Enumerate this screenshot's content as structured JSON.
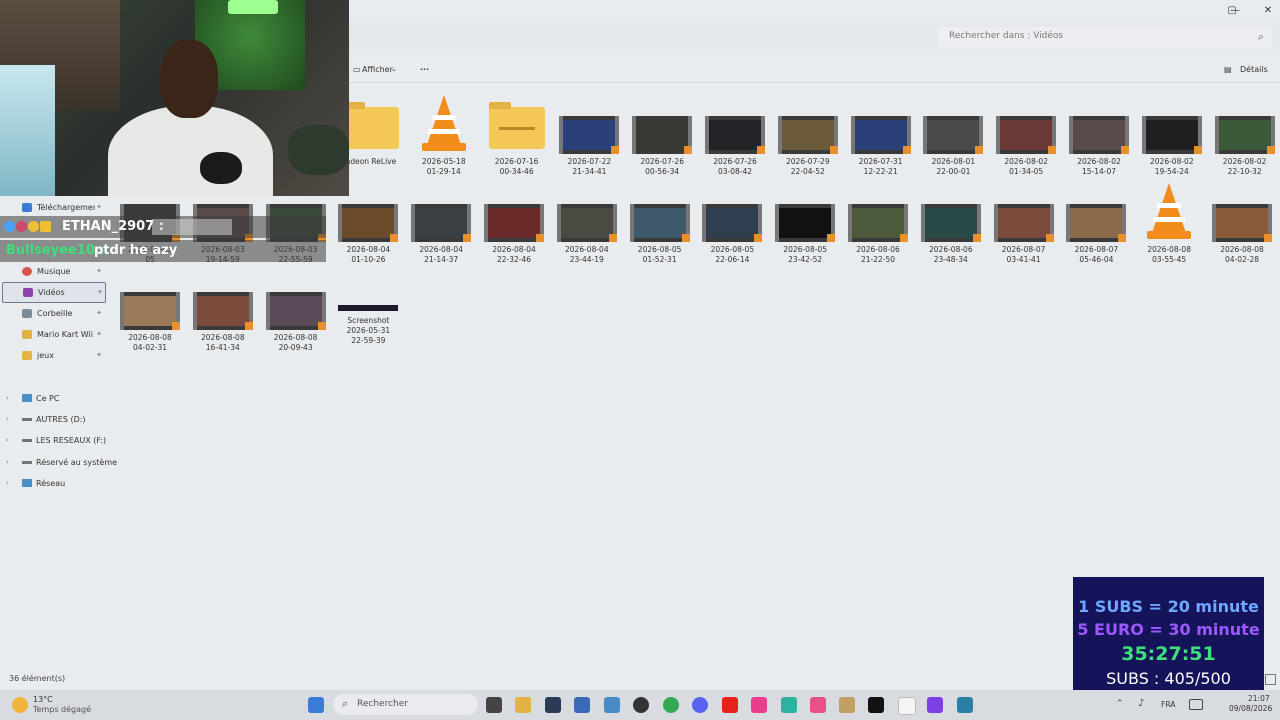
{
  "window": {
    "search_placeholder": "Rechercher dans : Vidéos",
    "search_icon": "search-icon",
    "minimize": "—",
    "maximize": "▢",
    "close": "✕"
  },
  "toolbar": {
    "view_label": "Afficher",
    "more_label": "···",
    "details_label": "Détails"
  },
  "sidebar": {
    "quick_access": [
      {
        "label": "Téléchargement",
        "icon": "download-icon",
        "color": "#3a7bd5"
      },
      {
        "label": "Musique",
        "icon": "music-icon",
        "color": "#d9534f"
      },
      {
        "label": "Vidéos",
        "icon": "video-icon",
        "color": "#8e44ad"
      },
      {
        "label": "Corbeille",
        "icon": "recycle-bin-icon",
        "color": "#7a8a99"
      },
      {
        "label": "Mario Kart Wii (F",
        "icon": "folder-icon",
        "color": "#e2b244"
      },
      {
        "label": "jeux",
        "icon": "folder-icon",
        "color": "#e2b244"
      }
    ],
    "tree": [
      {
        "label": "Ce PC",
        "icon": "pc-icon"
      },
      {
        "label": "AUTRES (D:)",
        "icon": "drive-icon"
      },
      {
        "label": "LES RESEAUX (F:)",
        "icon": "drive-icon"
      },
      {
        "label": "Réservé au système",
        "icon": "drive-icon"
      },
      {
        "label": "Réseau",
        "icon": "network-icon"
      }
    ]
  },
  "files_row1": [
    {
      "line1": "adeon ReLive",
      "line2": "",
      "kind": "folder"
    },
    {
      "line1": "2026-05-18",
      "line2": "01-29-14",
      "kind": "vlc"
    },
    {
      "line1": "2026-07-16",
      "line2": "00-34-46",
      "kind": "zipfolder"
    },
    {
      "line1": "2026-07-22",
      "line2": "21-34-41",
      "kind": "video",
      "tint": "#2b3f78"
    },
    {
      "line1": "2026-07-26",
      "line2": "00-56-34",
      "kind": "video",
      "tint": "#3a3a34"
    },
    {
      "line1": "2026-07-26",
      "line2": "03-08-42",
      "kind": "video",
      "tint": "#222428"
    },
    {
      "line1": "2026-07-29",
      "line2": "22-04-52",
      "kind": "video",
      "tint": "#6a5a3a"
    },
    {
      "line1": "2026-07-31",
      "line2": "12-22-21",
      "kind": "video",
      "tint": "#2b3f78"
    },
    {
      "line1": "2026-08-01",
      "line2": "22-00-01",
      "kind": "video",
      "tint": "#4a4a4a"
    },
    {
      "line1": "2026-08-02",
      "line2": "01-34-05",
      "kind": "video",
      "tint": "#6a3a38"
    },
    {
      "line1": "2026-08-02",
      "line2": "15-14-07",
      "kind": "video",
      "tint": "#5a4a4a"
    },
    {
      "line1": "2026-08-02",
      "line2": "19-54-24",
      "kind": "video",
      "tint": "#1f1f22"
    },
    {
      "line1": "2026-08-02",
      "line2": "22-10-32",
      "kind": "video",
      "tint": "#3a5a3a"
    }
  ],
  "files_row2": [
    {
      "line1": "2026-08-03",
      "line2": "05",
      "kind": "video",
      "tint": "#3a3a3a"
    },
    {
      "line1": "2026-08-03",
      "line2": "19-14-59",
      "kind": "video",
      "tint": "#5a4a4a"
    },
    {
      "line1": "2026-08-03",
      "line2": "22-55-59",
      "kind": "video",
      "tint": "#3b4a3a"
    },
    {
      "line1": "2026-08-04",
      "line2": "01-10-26",
      "kind": "video",
      "tint": "#6a4a2a"
    },
    {
      "line1": "2026-08-04",
      "line2": "21-14-37",
      "kind": "video",
      "tint": "#3a3f44"
    },
    {
      "line1": "2026-08-04",
      "line2": "22-32-46",
      "kind": "video",
      "tint": "#6a2a2a"
    },
    {
      "line1": "2026-08-04",
      "line2": "23-44-19",
      "kind": "video",
      "tint": "#4a4a40"
    },
    {
      "line1": "2026-08-05",
      "line2": "01-52-31",
      "kind": "video",
      "tint": "#3f5a6a"
    },
    {
      "line1": "2026-08-05",
      "line2": "22-06-14",
      "kind": "video",
      "tint": "#2f3f4f"
    },
    {
      "line1": "2026-08-05",
      "line2": "23-42-52",
      "kind": "video",
      "tint": "#111111"
    },
    {
      "line1": "2026-08-06",
      "line2": "21-22-50",
      "kind": "video",
      "tint": "#4a5a3a"
    },
    {
      "line1": "2026-08-06",
      "line2": "23-48-34",
      "kind": "video",
      "tint": "#2a4a4a"
    },
    {
      "line1": "2026-08-07",
      "line2": "03-41-41",
      "kind": "video",
      "tint": "#7a4a3a"
    },
    {
      "line1": "2026-08-07",
      "line2": "05-46-04",
      "kind": "video",
      "tint": "#8a6a4a"
    },
    {
      "line1": "2026-08-08",
      "line2": "03-55-45",
      "kind": "vlc"
    },
    {
      "line1": "2026-08-08",
      "line2": "04-02-28",
      "kind": "video",
      "tint": "#8a5a3a"
    }
  ],
  "files_row3": [
    {
      "line1": "2026-08-08",
      "line2": "04-02-31",
      "kind": "video",
      "tint": "#9a7a5a"
    },
    {
      "line1": "2026-08-08",
      "line2": "16-41-34",
      "kind": "video",
      "tint": "#7a4a3a"
    },
    {
      "line1": "2026-08-08",
      "line2": "20-09-43",
      "kind": "video",
      "tint": "#5a4a5a"
    },
    {
      "line1": "Screenshot",
      "line2": "2026-05-31",
      "line3": "22-59-39",
      "kind": "screenshot"
    }
  ],
  "status": {
    "item_count": "36 élément(s)"
  },
  "chat": [
    {
      "user": "ETHAN_2907 :",
      "message": "",
      "color": "#ffffff"
    },
    {
      "user": "Bullseyee10 :",
      "message": "ptdr he azy",
      "color": "#3ee07a"
    }
  ],
  "overlay": {
    "line1": "1 SUBS = 20 minute",
    "line2": "5 EURO = 30 minute",
    "timer": "35:27:51",
    "subs": "SUBS : 405/500",
    "colors": {
      "line1": "#6fa8ff",
      "line2": "#9b59ff",
      "timer": "#3ee07a",
      "subs": "#ffffff"
    }
  },
  "taskbar": {
    "weather_temp": "13°C",
    "weather_desc": "Temps dégagé",
    "search_label": "Rechercher",
    "lang": "FRA",
    "time": "21:07",
    "date": "09/08/2026"
  }
}
